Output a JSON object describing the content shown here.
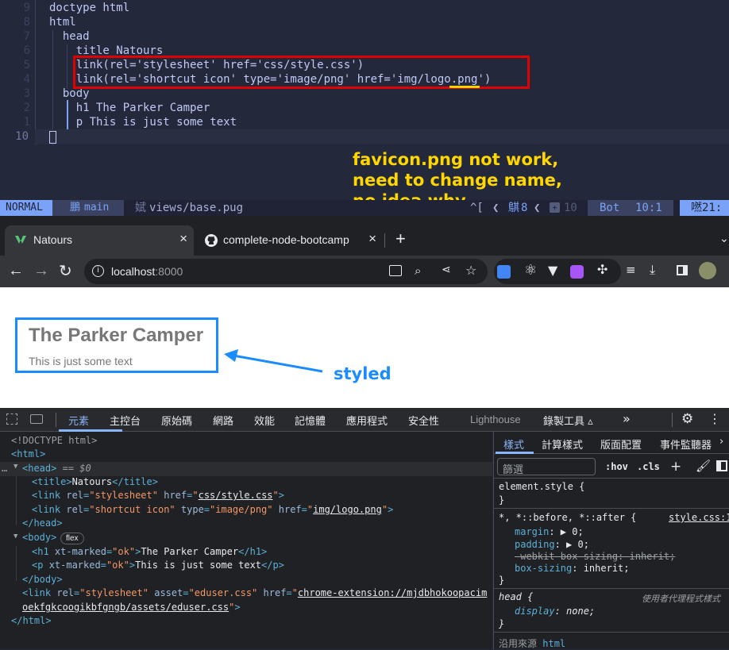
{
  "editor": {
    "line_numbers": [
      "9",
      "8",
      "7",
      "6",
      "5",
      "4",
      "3",
      "2",
      "1",
      "10"
    ],
    "lines": [
      "doctype html",
      "html",
      "  head",
      "    title Natours",
      "    link(rel='stylesheet' href='css/style.css')",
      "    link(rel='shortcut icon' type='image/png' href='img/logo.png')",
      "  body",
      "    h1 The Parker Camper",
      "    p This is just some text",
      ""
    ],
    "annotation": [
      "favicon.png not work,",
      "need to change name,",
      "no idea why"
    ]
  },
  "statusbar": {
    "mode": "NORMAL",
    "branch_icon": "鵬",
    "branch": "main",
    "file_icon": "娬",
    "file": "views/base.pug",
    "caret": "^[",
    "diag_icon": "鶀",
    "diag_count": "8",
    "add_count": "10",
    "position_label": "Bot",
    "cursor": "10:1",
    "time_icon": "嘫",
    "time": "21:"
  },
  "browser": {
    "tabs": [
      {
        "title": "Natours",
        "close": "×"
      },
      {
        "title": "complete-node-bootcamp",
        "close": "×"
      }
    ],
    "new_tab": "+",
    "url_host": "localhost",
    "url_port": ":8000"
  },
  "page": {
    "heading": "The Parker Camper",
    "paragraph": "This is just some text",
    "styled_label": "styled"
  },
  "devtools": {
    "tabs": [
      "元素",
      "主控台",
      "原始碼",
      "網路",
      "效能",
      "記憶體",
      "應用程式",
      "安全性",
      "Lighthouse",
      "錄製工具 ▵"
    ],
    "more": "»",
    "dom_lines": [
      {
        "t": "<!DOCTYPE html>",
        "x": 14
      },
      {
        "t": "<html>",
        "x": 14
      },
      {
        "t": "<head> == $0",
        "x": 28
      },
      {
        "t": "<title>Natours</title>",
        "x": 40
      },
      {
        "t": "<link rel=\"stylesheet\" href=\"css/style.css\">",
        "x": 40
      },
      {
        "t": "<link rel=\"shortcut icon\" type=\"image/png\" href=\"img/logo.png\">",
        "x": 40
      },
      {
        "t": "</head>",
        "x": 28
      },
      {
        "t": "<body>",
        "x": 28
      },
      {
        "t": "<h1 xt-marked=\"ok\">The Parker Camper</h1>",
        "x": 40
      },
      {
        "t": "<p xt-marked=\"ok\">This is just some text</p>",
        "x": 40
      },
      {
        "t": "</body>",
        "x": 28
      },
      {
        "t": "<link rel=\"stylesheet\" asset=\"eduser.css\" href=\"chrome-extension://mjdbhokoopacim",
        "x": 28
      },
      {
        "t": "oekfgkcoogikbfgngb/assets/eduser.css\">",
        "x": 28
      },
      {
        "t": "</html>",
        "x": 14
      }
    ],
    "flex_badge": "flex",
    "style_tabs": [
      "樣式",
      "計算樣式",
      "版面配置",
      "事件監聽器"
    ],
    "filter_placeholder": "篩選",
    "hov": ":hov",
    "cls": ".cls",
    "rules": {
      "element_style": "element.style {",
      "close": "}",
      "universal_selector": "*, *::before, *::after {",
      "universal_source": "style.css:1",
      "margin": "margin: ▶ 0;",
      "padding": "padding: ▶ 0;",
      "webkit": "-webkit-box-sizing: inherit;",
      "box_sizing": "box-sizing: inherit;",
      "head_selector": "head {",
      "ua_label": "使用者代理程式樣式",
      "display": "display: none;",
      "inherited": "沿用來源",
      "inherited_from": "html"
    }
  },
  "colors": {
    "editor_bg": "#24283b",
    "annotation": "#ffd700",
    "highlight_box": "#e00000",
    "arrow_blue": "#1a8cff",
    "styled_text": "#1a8cff"
  }
}
